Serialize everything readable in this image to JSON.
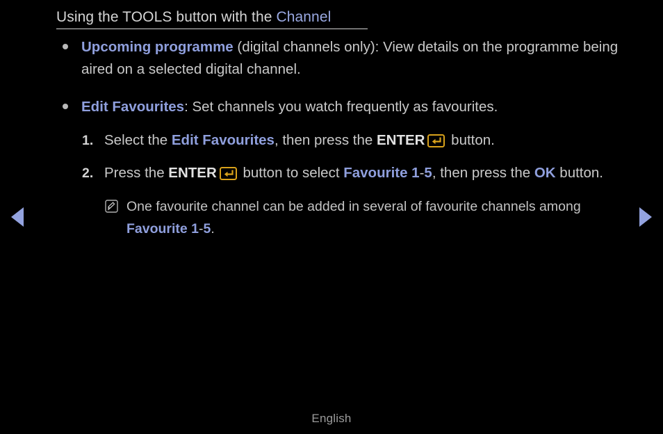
{
  "screen": {
    "background_color": "#000000",
    "text_color": "#c9c9c9",
    "accent_blue": "#8f9fdd",
    "accent_gold": "#d9a21b"
  },
  "title": {
    "lead": "Using the TOOLS button with the ",
    "accent": "Channel"
  },
  "bullets": [
    {
      "marker": "•",
      "term": "Upcoming programme",
      "rest": " (digital channels only): View details on the programme being aired on a selected digital channel."
    },
    {
      "marker": "•",
      "term": "Edit Favourites",
      "rest": ": Set channels you watch frequently as favourites."
    }
  ],
  "steps": [
    {
      "number": "1.",
      "part1": "Select the ",
      "highlight1": "Edit Favourites",
      "part2": ", then press the ",
      "key_label": "ENTER",
      "key_icon": "enter-key-icon",
      "part3": " button."
    },
    {
      "number": "2.",
      "part1": "Press the ",
      "key_label": "ENTER",
      "key_icon": "enter-key-icon",
      "part2": " button to select ",
      "highlight1": "Favourite 1",
      "separator": "-",
      "highlight2": "5",
      "part3": ", then press the ",
      "highlight3": "OK",
      "part4": " button."
    }
  ],
  "note": {
    "icon": "note-pencil-icon",
    "part1": "One favourite channel can be added in several of favourite channels among ",
    "highlight1": "Favourite 1",
    "separator": "-",
    "highlight2": "5",
    "part2": "."
  },
  "navigation": {
    "prev_icon": "triangle-left-icon",
    "prev_label": "Previous page",
    "next_icon": "triangle-right-icon",
    "next_label": "Next page"
  },
  "footer": {
    "language": "English"
  }
}
